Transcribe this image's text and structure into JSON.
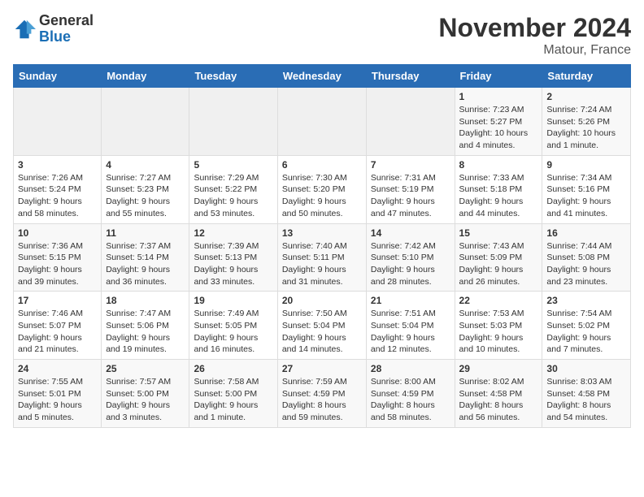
{
  "header": {
    "logo_general": "General",
    "logo_blue": "Blue",
    "month_title": "November 2024",
    "location": "Matour, France"
  },
  "days_of_week": [
    "Sunday",
    "Monday",
    "Tuesday",
    "Wednesday",
    "Thursday",
    "Friday",
    "Saturday"
  ],
  "weeks": [
    [
      {
        "day": "",
        "info": ""
      },
      {
        "day": "",
        "info": ""
      },
      {
        "day": "",
        "info": ""
      },
      {
        "day": "",
        "info": ""
      },
      {
        "day": "",
        "info": ""
      },
      {
        "day": "1",
        "info": "Sunrise: 7:23 AM\nSunset: 5:27 PM\nDaylight: 10 hours and 4 minutes."
      },
      {
        "day": "2",
        "info": "Sunrise: 7:24 AM\nSunset: 5:26 PM\nDaylight: 10 hours and 1 minute."
      }
    ],
    [
      {
        "day": "3",
        "info": "Sunrise: 7:26 AM\nSunset: 5:24 PM\nDaylight: 9 hours and 58 minutes."
      },
      {
        "day": "4",
        "info": "Sunrise: 7:27 AM\nSunset: 5:23 PM\nDaylight: 9 hours and 55 minutes."
      },
      {
        "day": "5",
        "info": "Sunrise: 7:29 AM\nSunset: 5:22 PM\nDaylight: 9 hours and 53 minutes."
      },
      {
        "day": "6",
        "info": "Sunrise: 7:30 AM\nSunset: 5:20 PM\nDaylight: 9 hours and 50 minutes."
      },
      {
        "day": "7",
        "info": "Sunrise: 7:31 AM\nSunset: 5:19 PM\nDaylight: 9 hours and 47 minutes."
      },
      {
        "day": "8",
        "info": "Sunrise: 7:33 AM\nSunset: 5:18 PM\nDaylight: 9 hours and 44 minutes."
      },
      {
        "day": "9",
        "info": "Sunrise: 7:34 AM\nSunset: 5:16 PM\nDaylight: 9 hours and 41 minutes."
      }
    ],
    [
      {
        "day": "10",
        "info": "Sunrise: 7:36 AM\nSunset: 5:15 PM\nDaylight: 9 hours and 39 minutes."
      },
      {
        "day": "11",
        "info": "Sunrise: 7:37 AM\nSunset: 5:14 PM\nDaylight: 9 hours and 36 minutes."
      },
      {
        "day": "12",
        "info": "Sunrise: 7:39 AM\nSunset: 5:13 PM\nDaylight: 9 hours and 33 minutes."
      },
      {
        "day": "13",
        "info": "Sunrise: 7:40 AM\nSunset: 5:11 PM\nDaylight: 9 hours and 31 minutes."
      },
      {
        "day": "14",
        "info": "Sunrise: 7:42 AM\nSunset: 5:10 PM\nDaylight: 9 hours and 28 minutes."
      },
      {
        "day": "15",
        "info": "Sunrise: 7:43 AM\nSunset: 5:09 PM\nDaylight: 9 hours and 26 minutes."
      },
      {
        "day": "16",
        "info": "Sunrise: 7:44 AM\nSunset: 5:08 PM\nDaylight: 9 hours and 23 minutes."
      }
    ],
    [
      {
        "day": "17",
        "info": "Sunrise: 7:46 AM\nSunset: 5:07 PM\nDaylight: 9 hours and 21 minutes."
      },
      {
        "day": "18",
        "info": "Sunrise: 7:47 AM\nSunset: 5:06 PM\nDaylight: 9 hours and 19 minutes."
      },
      {
        "day": "19",
        "info": "Sunrise: 7:49 AM\nSunset: 5:05 PM\nDaylight: 9 hours and 16 minutes."
      },
      {
        "day": "20",
        "info": "Sunrise: 7:50 AM\nSunset: 5:04 PM\nDaylight: 9 hours and 14 minutes."
      },
      {
        "day": "21",
        "info": "Sunrise: 7:51 AM\nSunset: 5:04 PM\nDaylight: 9 hours and 12 minutes."
      },
      {
        "day": "22",
        "info": "Sunrise: 7:53 AM\nSunset: 5:03 PM\nDaylight: 9 hours and 10 minutes."
      },
      {
        "day": "23",
        "info": "Sunrise: 7:54 AM\nSunset: 5:02 PM\nDaylight: 9 hours and 7 minutes."
      }
    ],
    [
      {
        "day": "24",
        "info": "Sunrise: 7:55 AM\nSunset: 5:01 PM\nDaylight: 9 hours and 5 minutes."
      },
      {
        "day": "25",
        "info": "Sunrise: 7:57 AM\nSunset: 5:00 PM\nDaylight: 9 hours and 3 minutes."
      },
      {
        "day": "26",
        "info": "Sunrise: 7:58 AM\nSunset: 5:00 PM\nDaylight: 9 hours and 1 minute."
      },
      {
        "day": "27",
        "info": "Sunrise: 7:59 AM\nSunset: 4:59 PM\nDaylight: 8 hours and 59 minutes."
      },
      {
        "day": "28",
        "info": "Sunrise: 8:00 AM\nSunset: 4:59 PM\nDaylight: 8 hours and 58 minutes."
      },
      {
        "day": "29",
        "info": "Sunrise: 8:02 AM\nSunset: 4:58 PM\nDaylight: 8 hours and 56 minutes."
      },
      {
        "day": "30",
        "info": "Sunrise: 8:03 AM\nSunset: 4:58 PM\nDaylight: 8 hours and 54 minutes."
      }
    ]
  ]
}
